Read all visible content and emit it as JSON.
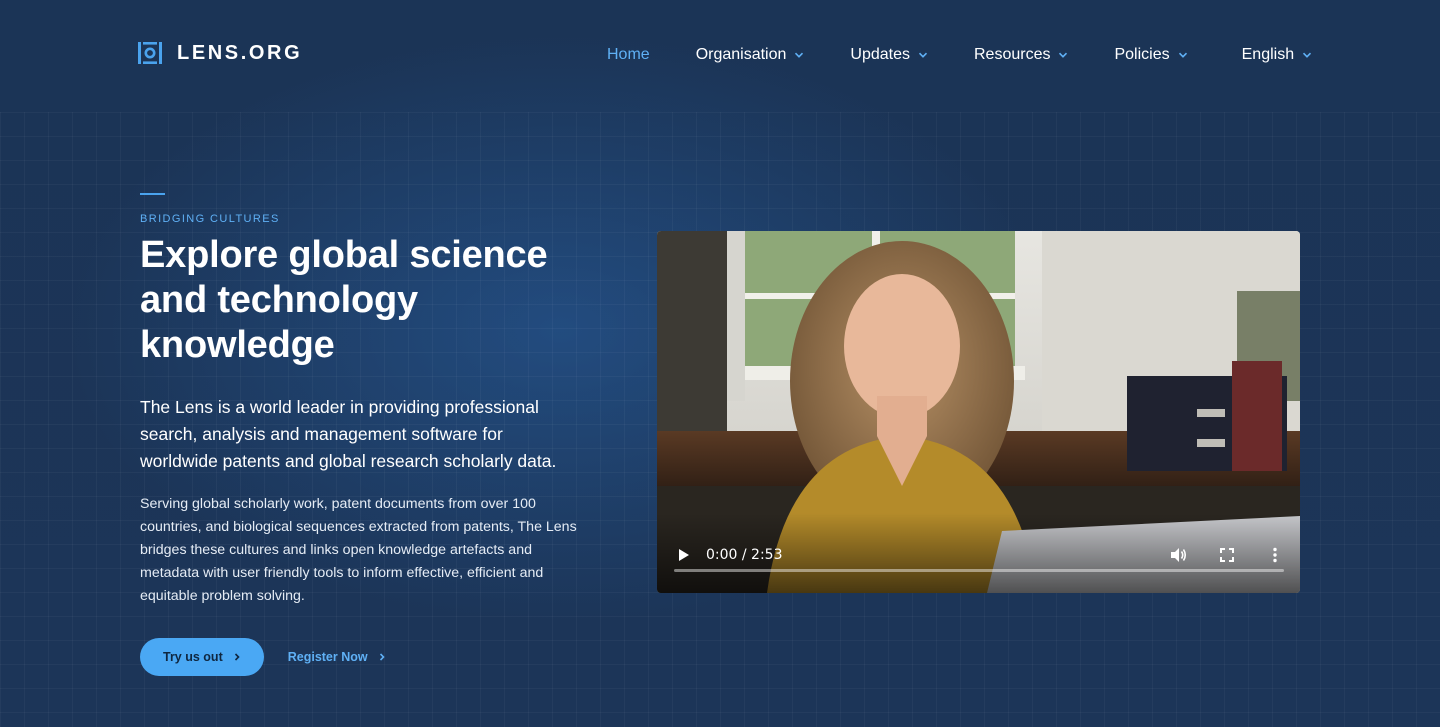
{
  "brand": {
    "name": "LENS.ORG"
  },
  "nav": {
    "items": [
      {
        "label": "Home",
        "active": true,
        "dropdown": false
      },
      {
        "label": "Organisation",
        "active": false,
        "dropdown": true
      },
      {
        "label": "Updates",
        "active": false,
        "dropdown": true
      },
      {
        "label": "Resources",
        "active": false,
        "dropdown": true
      },
      {
        "label": "Policies",
        "active": false,
        "dropdown": true
      },
      {
        "label": "English",
        "active": false,
        "dropdown": true
      }
    ]
  },
  "hero": {
    "eyebrow": "BRIDGING CULTURES",
    "title": "Explore global science and technology knowledge",
    "lead": "The Lens is a world leader in providing professional search, analysis and management software for worldwide patents and global research scholarly data.",
    "body": "Serving global scholarly work, patent documents from over 100 countries, and biological sequences extracted from patents, The Lens bridges these cultures and links open knowledge artefacts and metadata with user friendly tools to inform effective, efficient and equitable problem solving.",
    "primary_cta": "Try us out",
    "secondary_cta": "Register Now"
  },
  "video": {
    "time": "0:00 / 2:53",
    "progress": 0
  },
  "colors": {
    "background": "#1b3456",
    "accent": "#4aa8f4",
    "nav_active": "#5fb0f5"
  },
  "icons": [
    "lens-logo-icon",
    "chevron-down-icon",
    "chevron-right-icon",
    "play-icon",
    "volume-icon",
    "fullscreen-icon",
    "more-vert-icon"
  ]
}
